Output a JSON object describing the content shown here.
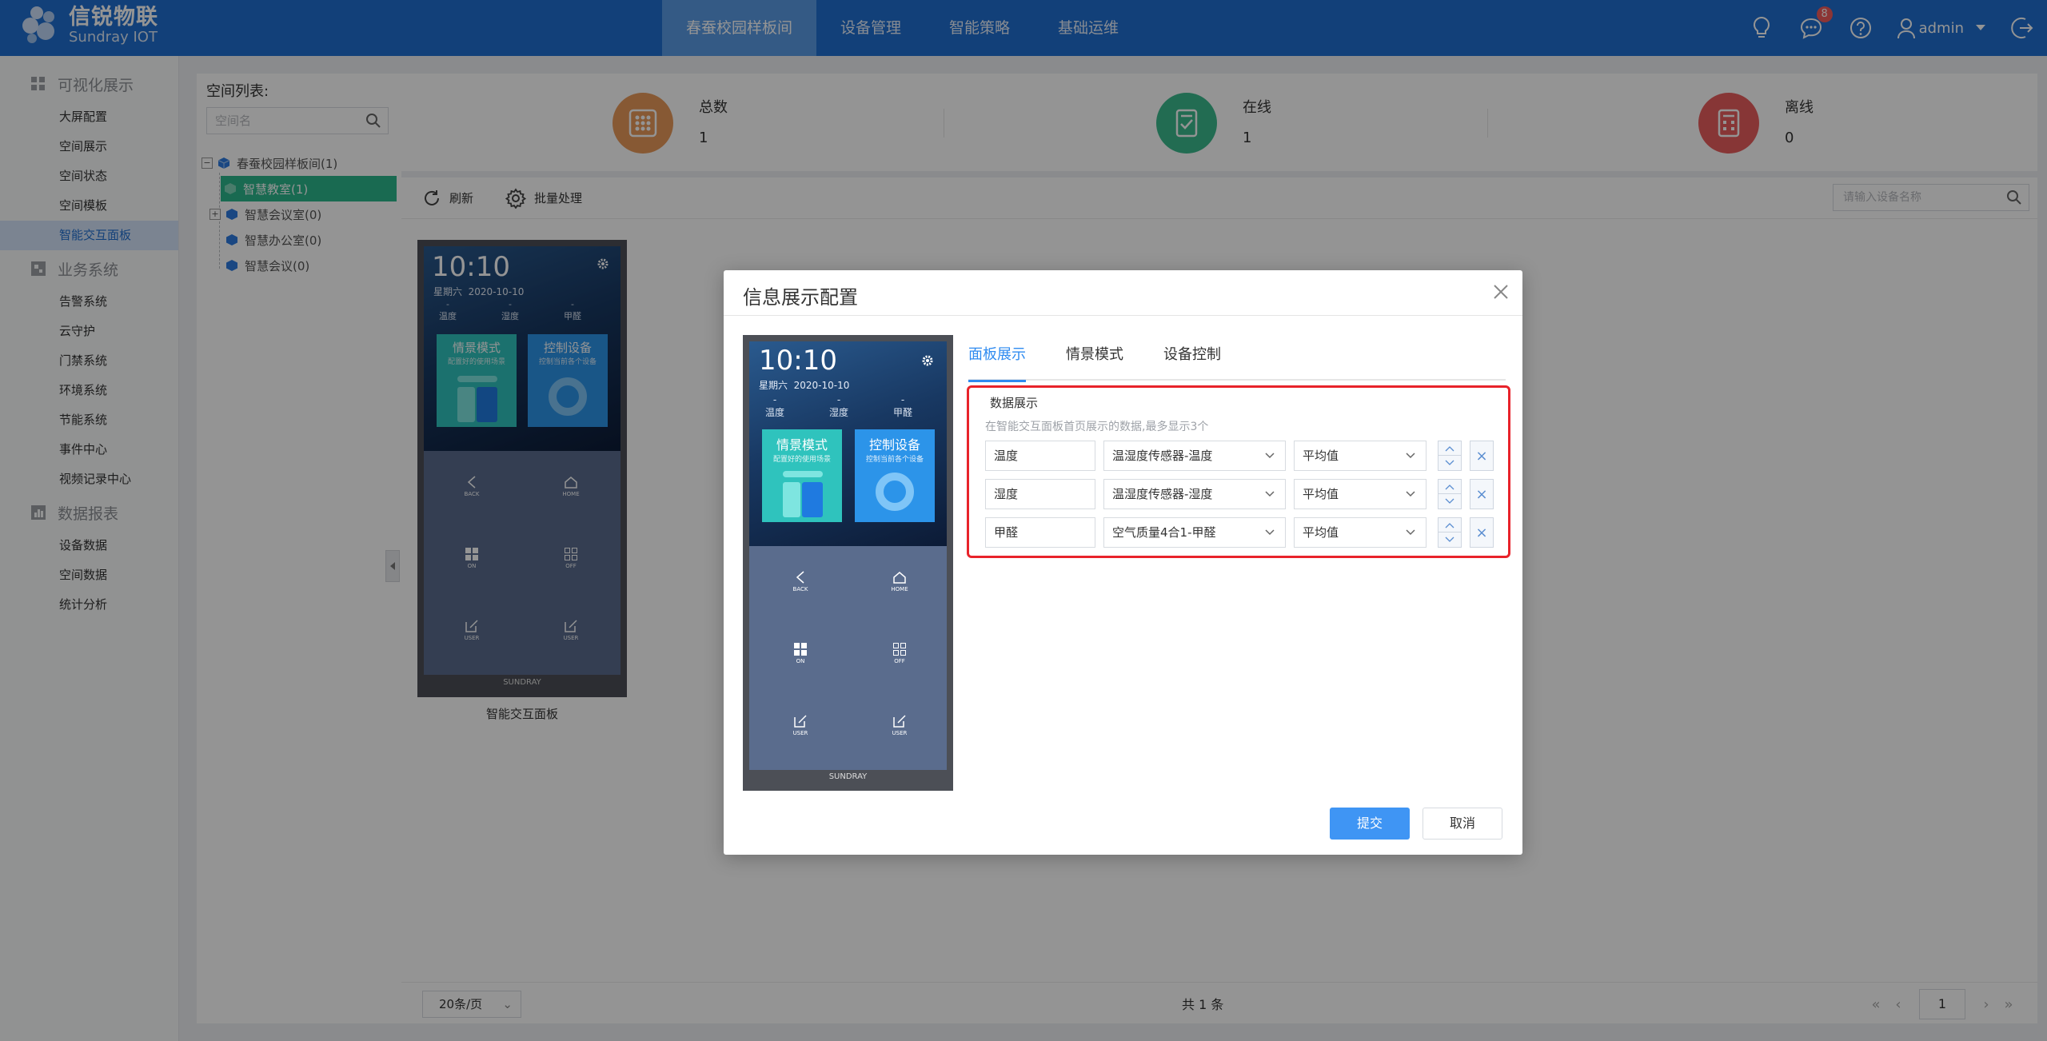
{
  "header": {
    "logo_cn": "信锐物联",
    "logo_en": "Sundray IOT",
    "nav": [
      {
        "label": "春蚕校园样板间",
        "active": true
      },
      {
        "label": "设备管理",
        "active": false
      },
      {
        "label": "智能策略",
        "active": false
      },
      {
        "label": "基础运维",
        "active": false
      }
    ],
    "message_badge": "8",
    "user": "admin"
  },
  "sidebar": {
    "groups": [
      {
        "label": "可视化展示",
        "icon": "dashboard-icon",
        "items": [
          "大屏配置",
          "空间展示",
          "空间状态",
          "空间模板",
          "智能交互面板"
        ]
      },
      {
        "label": "业务系统",
        "icon": "business-icon",
        "items": [
          "告警系统",
          "云守护",
          "门禁系统",
          "环境系统",
          "节能系统",
          "事件中心",
          "视频记录中心"
        ]
      },
      {
        "label": "数据报表",
        "icon": "report-icon",
        "items": [
          "设备数据",
          "空间数据",
          "统计分析"
        ]
      }
    ],
    "active_item": "智能交互面板"
  },
  "tree": {
    "title": "空间列表:",
    "search_placeholder": "空间名",
    "root": "春蚕校园样板间(1)",
    "children": [
      "智慧教室(1)",
      "智慧会议室(0)",
      "智慧办公室(0)",
      "智慧会议(0)"
    ]
  },
  "stats": [
    {
      "label": "总数",
      "value": "1",
      "color": "#e8995a"
    },
    {
      "label": "在线",
      "value": "1",
      "color": "#3cba8e"
    },
    {
      "label": "离线",
      "value": "0",
      "color": "#e85e5e"
    }
  ],
  "toolbar": {
    "refresh": "刷新",
    "batch": "批量处理",
    "search_placeholder": "请输入设备名称"
  },
  "device": {
    "name": "智能交互面板"
  },
  "panel_screen": {
    "time": "10:10",
    "weekday": "星期六",
    "date": "2020-10-10",
    "dash": "-",
    "sensors": [
      "温度",
      "湿度",
      "甲醛"
    ],
    "tile_scene_title": "情景模式",
    "tile_scene_sub": "配置好的使用场景",
    "tile_control_title": "控制设备",
    "tile_control_sub": "控制当前各个设备",
    "keys": [
      "BACK",
      "HOME",
      "ON",
      "OFF",
      "USER",
      "USER"
    ],
    "footer": "SUNDRAY"
  },
  "pager": {
    "page_size": "20条/页",
    "total": "共 1 条",
    "current_page": "1"
  },
  "modal": {
    "title": "信息展示配置",
    "tabs": [
      "面板展示",
      "情景模式",
      "设备控制"
    ],
    "section_title": "数据展示",
    "hint": "在智能交互面板首页展示的数据,最多显示3个",
    "rows": [
      {
        "name": "温度",
        "source": "温湿度传感器-温度",
        "agg": "平均值"
      },
      {
        "name": "湿度",
        "source": "温湿度传感器-湿度",
        "agg": "平均值"
      },
      {
        "name": "甲醛",
        "source": "空气质量4合1-甲醛",
        "agg": "平均值"
      }
    ],
    "submit": "提交",
    "cancel": "取消"
  }
}
